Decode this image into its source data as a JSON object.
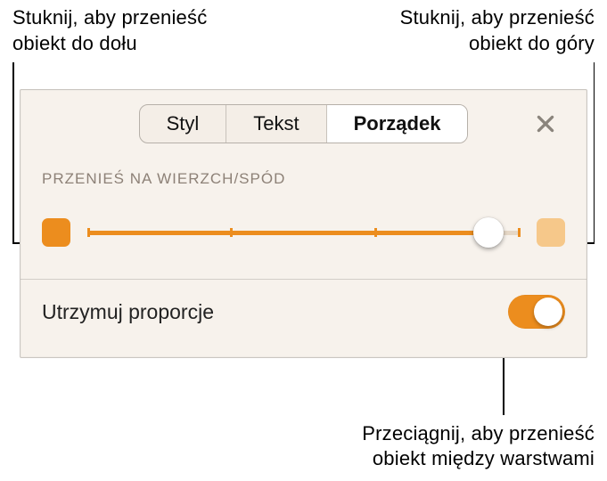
{
  "callouts": {
    "top_left_line1": "Stuknij, aby przenieść",
    "top_left_line2": "obiekt do dołu",
    "top_right_line1": "Stuknij, aby przenieść",
    "top_right_line2": "obiekt do góry",
    "bottom_line1": "Przeciągnij, aby przenieść",
    "bottom_line2": "obiekt między warstwami"
  },
  "tabs": {
    "style": "Styl",
    "text": "Tekst",
    "order": "Porządek"
  },
  "section": {
    "layer_label": "PRZENIEŚ NA WIERZCH/SPÓD"
  },
  "slider": {
    "position_fraction": 0.93,
    "tick_positions": [
      0,
      0.333,
      0.667,
      1
    ]
  },
  "keep_proportions": {
    "label": "Utrzymuj proporcje",
    "on": true
  },
  "colors": {
    "accent": "#ec8d1e",
    "accent_disabled": "#f6c88a"
  }
}
